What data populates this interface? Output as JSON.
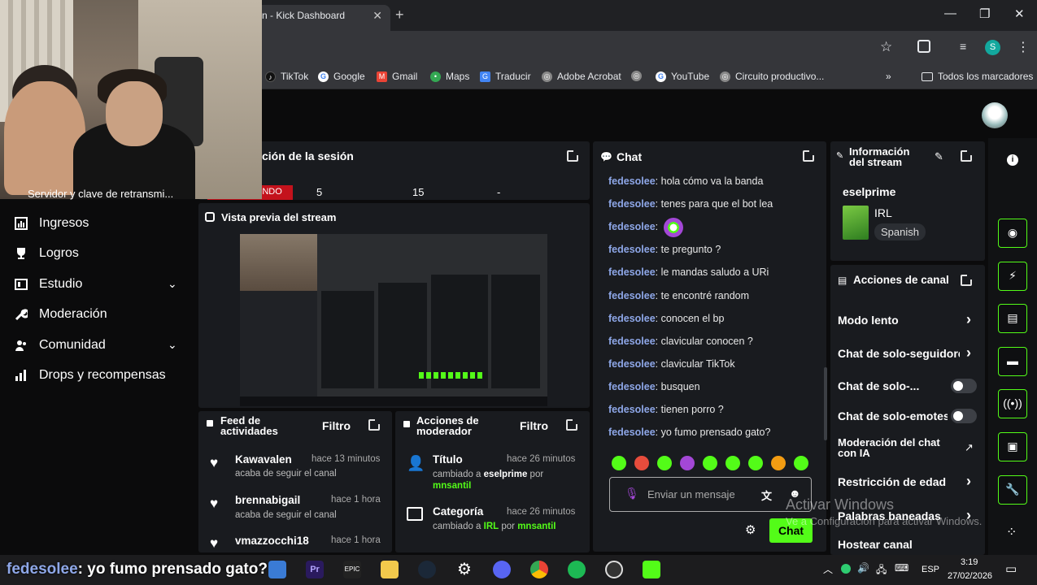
{
  "browser": {
    "tab_title": "n - Kick Dashboard",
    "bookmarks": [
      "TikTok",
      "Google",
      "Gmail",
      "Maps",
      "Traducir",
      "Adobe Acrobat",
      "YouTube",
      "Circuito productivo...",
      "Todos los marcadores"
    ],
    "profile_initial": "S"
  },
  "sidebar": {
    "items": [
      {
        "label": "Ingresos",
        "icon": "bar-chart-icon"
      },
      {
        "label": "Logros",
        "icon": "trophy-icon"
      },
      {
        "label": "Estudio",
        "icon": "studio-icon"
      },
      {
        "label": "Moderación",
        "icon": "wrench-icon"
      },
      {
        "label": "Comunidad",
        "icon": "community-icon"
      },
      {
        "label": "Drops y recompensas",
        "icon": "drops-icon"
      }
    ]
  },
  "session": {
    "title": "ción de la sesión",
    "live_label": "ENDO",
    "values": [
      "5",
      "15",
      "-"
    ],
    "cam_overlay_text": "Servidor y clave de retransmi..."
  },
  "preview": {
    "title": "Vista previa del stream"
  },
  "chat": {
    "title": "Chat",
    "messages": [
      {
        "user": "fedesolee",
        "text": ": hola cómo va la banda"
      },
      {
        "user": "fedesolee",
        "text": ": tenes para que el bot lea"
      },
      {
        "user": "fedesolee",
        "text": ":"
      },
      {
        "user": "fedesolee",
        "text": ": te pregunto ?"
      },
      {
        "user": "fedesolee",
        "text": ": le mandas saludo a URi"
      },
      {
        "user": "fedesolee",
        "text": ": te encontré random"
      },
      {
        "user": "fedesolee",
        "text": ": conocen el bp"
      },
      {
        "user": "fedesolee",
        "text": ": clavicular conocen ?"
      },
      {
        "user": "fedesolee",
        "text": ": clavicular TikTok"
      },
      {
        "user": "fedesolee",
        "text": ": busquen"
      },
      {
        "user": "fedesolee",
        "text": ": tienen porro ?"
      },
      {
        "user": "fedesolee",
        "text": ": yo fumo prensado gato?"
      }
    ],
    "input_placeholder": "Enviar un mensaje",
    "send_label": "Chat"
  },
  "stream_info": {
    "title": "Información del stream",
    "channel": "eselprime",
    "category": "IRL",
    "language": "Spanish"
  },
  "channel_actions": {
    "title": "Acciones de canal",
    "items": [
      {
        "label": "Modo lento",
        "kind": "arrow"
      },
      {
        "label": "Chat de solo-seguidores",
        "kind": "arrow"
      },
      {
        "label": "Chat de solo-...",
        "kind": "toggle"
      },
      {
        "label": "Chat de solo-emotes",
        "kind": "toggle"
      },
      {
        "label": "Moderación del chat con IA",
        "kind": "external"
      },
      {
        "label": "Restricción de edad",
        "kind": "arrow"
      },
      {
        "label": "Palabras baneadas",
        "kind": "arrow"
      },
      {
        "label": "Hostear canal",
        "kind": "none"
      }
    ]
  },
  "activity_feed": {
    "title": "Feed de actividades",
    "filter": "Filtro",
    "items": [
      {
        "user": "Kawavalen",
        "time": "hace 13 minutos",
        "text": "acaba de seguir el canal"
      },
      {
        "user": "brennabigail",
        "time": "hace 1 hora",
        "text": "acaba de seguir el canal"
      },
      {
        "user": "vmazzocchi18",
        "time": "hace 1 hora",
        "text": ""
      }
    ]
  },
  "mod_actions": {
    "title": "Acciones de moderador",
    "filter": "Filtro",
    "items": [
      {
        "title": "Título",
        "time": "hace 26 minutos",
        "prefix": "cambiado a ",
        "value": "eselprime",
        "by": " por ",
        "mod": "mnsantiI"
      },
      {
        "title": "Categoría",
        "time": "hace 26 minutos",
        "prefix": "cambiado a ",
        "value": "IRL",
        "by": " por ",
        "mod": "mnsantiI"
      }
    ]
  },
  "caption": {
    "user": "fedesolee",
    "text": ": yo fumo prensado gato?"
  },
  "watermark": {
    "line1": "Activar Windows",
    "line2": "Ve a Configuración para activar Windows."
  },
  "taskbar": {
    "language": "ESP",
    "time": "3:19",
    "date": "27/02/2026"
  },
  "colors": {
    "accent": "#53fc18",
    "panel": "#191b1f",
    "username": "#8ea7e8",
    "live": "#c4121c"
  }
}
